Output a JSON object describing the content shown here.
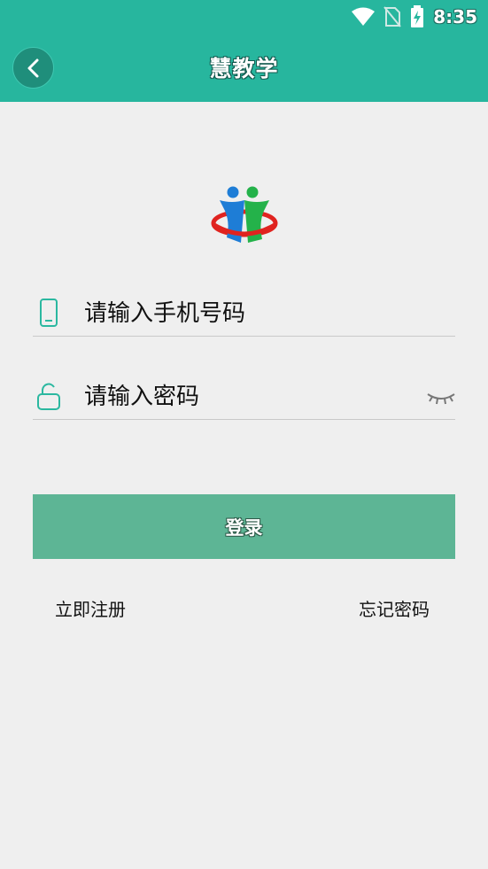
{
  "status_bar": {
    "time": "8:35"
  },
  "header": {
    "title": "慧教学"
  },
  "form": {
    "phone": {
      "placeholder": "请输入手机号码",
      "value": ""
    },
    "password": {
      "placeholder": "请输入密码",
      "value": ""
    }
  },
  "actions": {
    "login_label": "登录",
    "register_label": "立即注册",
    "forgot_label": "忘记密码"
  },
  "colors": {
    "header_bg": "#27b69e",
    "button_bg": "#5db595",
    "page_bg": "#efefef",
    "icon_teal": "#2bb8a0"
  },
  "icons": [
    "wifi-icon",
    "no-sim-icon",
    "battery-charging-icon",
    "back-arrow-icon",
    "app-logo-icon",
    "phone-icon",
    "lock-icon",
    "eye-closed-icon"
  ]
}
